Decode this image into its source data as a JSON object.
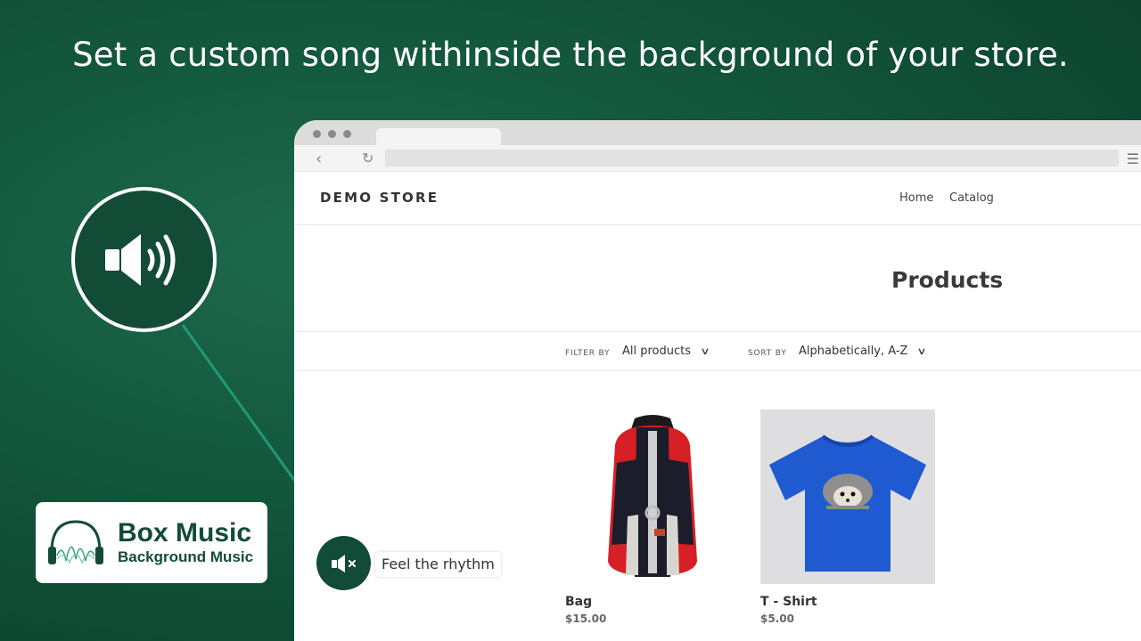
{
  "headline": "Set a custom song withinside the background of your store.",
  "brand": {
    "title": "Box Music",
    "subtitle": "Background Music",
    "color": "#134c36"
  },
  "browser": {
    "url": ""
  },
  "store": {
    "name": "DEMO STORE",
    "nav": [
      "Home",
      "Catalog"
    ],
    "page_title": "Products",
    "filter": {
      "label": "FILTER BY",
      "value": "All products"
    },
    "sort": {
      "label": "SORT BY",
      "value": "Alphabetically, A-Z"
    },
    "products": [
      {
        "name": "Bag",
        "price": "$15.00",
        "image": "red-black-backpack"
      },
      {
        "name": "T - Shirt",
        "price": "$5.00",
        "image": "blue-tshirt-hedgehog"
      }
    ]
  },
  "player": {
    "label": "Feel the rhythm",
    "state": "muted",
    "icon": "speaker-mute-icon"
  },
  "icons": {
    "big_speaker": "speaker-sound-icon"
  },
  "colors": {
    "background": "#145a3e",
    "accent_arrow": "#1f9a75",
    "player": "#134c36"
  }
}
